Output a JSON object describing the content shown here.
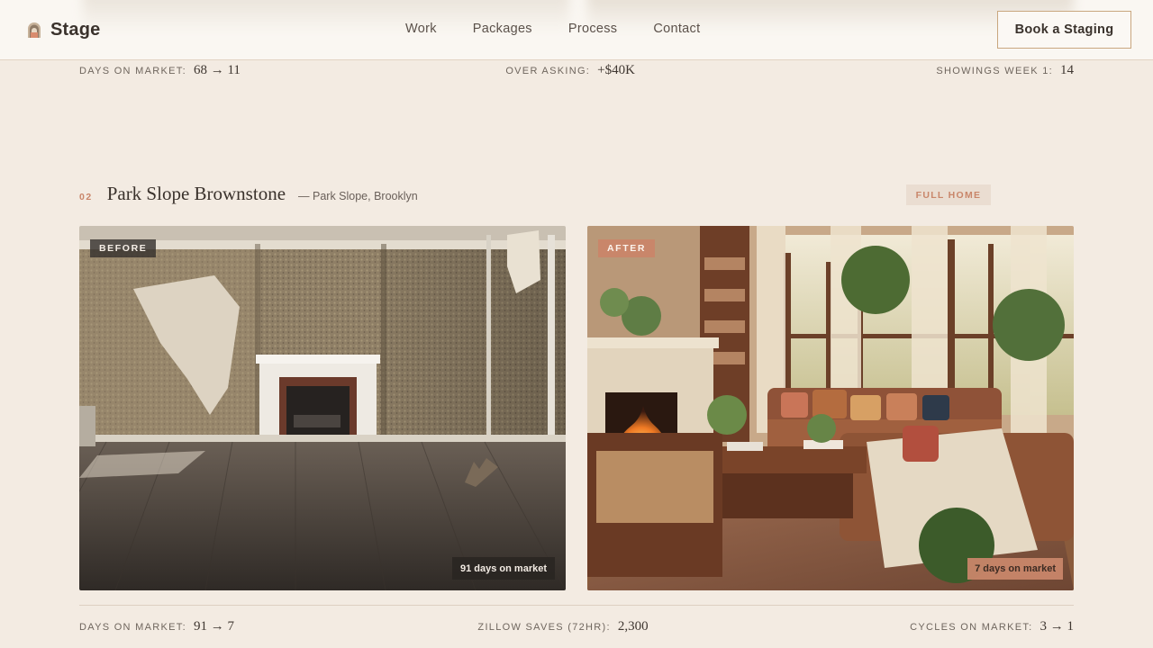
{
  "header": {
    "logo_text": "Stage",
    "logo_icon": "arch-door-icon",
    "nav": [
      "Work",
      "Packages",
      "Process",
      "Contact"
    ],
    "cta_label": "Book a Staging"
  },
  "stats_top": [
    {
      "label": "DAYS ON MARKET:",
      "value": "68 → 11"
    },
    {
      "label": "OVER ASKING:",
      "value": "+$40K"
    },
    {
      "label": "SHOWINGS WEEK 1:",
      "value": "14"
    }
  ],
  "project": {
    "number": "02",
    "title": "Park Slope Brownstone",
    "location": "— Park Slope, Brooklyn",
    "tag": "FULL HOME",
    "before": {
      "label": "BEFORE",
      "caption": "91 days on market"
    },
    "after": {
      "label": "AFTER",
      "caption": "7 days on market"
    }
  },
  "stats_bottom": [
    {
      "label": "DAYS ON MARKET:",
      "value": "91 → 7"
    },
    {
      "label": "ZILLOW SAVES (72HR):",
      "value": "2,300"
    },
    {
      "label": "CYCLES ON MARKET:",
      "value": "3 → 1"
    }
  ],
  "colors": {
    "background": "#f3ebe2",
    "accent": "#c9866a",
    "text": "#3a322c",
    "border": "#c9a77f"
  }
}
